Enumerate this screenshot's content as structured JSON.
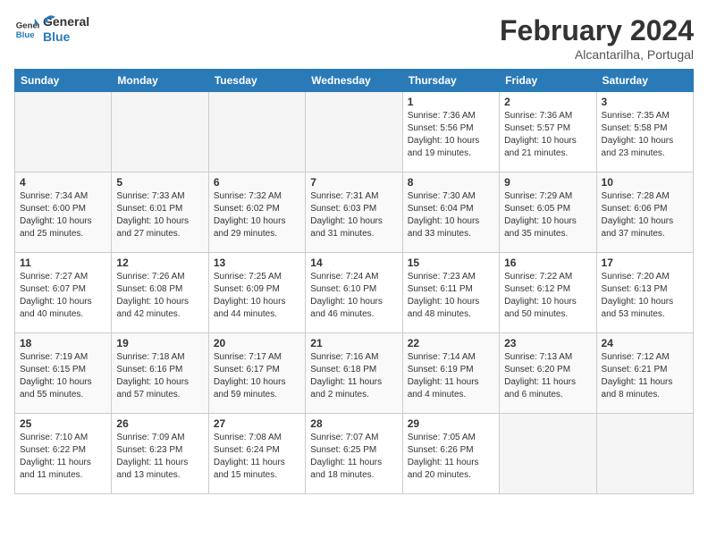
{
  "header": {
    "logo_line1": "General",
    "logo_line2": "Blue",
    "month_year": "February 2024",
    "location": "Alcantarilha, Portugal"
  },
  "days_of_week": [
    "Sunday",
    "Monday",
    "Tuesday",
    "Wednesday",
    "Thursday",
    "Friday",
    "Saturday"
  ],
  "weeks": [
    [
      {
        "day": "",
        "info": ""
      },
      {
        "day": "",
        "info": ""
      },
      {
        "day": "",
        "info": ""
      },
      {
        "day": "",
        "info": ""
      },
      {
        "day": "1",
        "info": "Sunrise: 7:36 AM\nSunset: 5:56 PM\nDaylight: 10 hours\nand 19 minutes."
      },
      {
        "day": "2",
        "info": "Sunrise: 7:36 AM\nSunset: 5:57 PM\nDaylight: 10 hours\nand 21 minutes."
      },
      {
        "day": "3",
        "info": "Sunrise: 7:35 AM\nSunset: 5:58 PM\nDaylight: 10 hours\nand 23 minutes."
      }
    ],
    [
      {
        "day": "4",
        "info": "Sunrise: 7:34 AM\nSunset: 6:00 PM\nDaylight: 10 hours\nand 25 minutes."
      },
      {
        "day": "5",
        "info": "Sunrise: 7:33 AM\nSunset: 6:01 PM\nDaylight: 10 hours\nand 27 minutes."
      },
      {
        "day": "6",
        "info": "Sunrise: 7:32 AM\nSunset: 6:02 PM\nDaylight: 10 hours\nand 29 minutes."
      },
      {
        "day": "7",
        "info": "Sunrise: 7:31 AM\nSunset: 6:03 PM\nDaylight: 10 hours\nand 31 minutes."
      },
      {
        "day": "8",
        "info": "Sunrise: 7:30 AM\nSunset: 6:04 PM\nDaylight: 10 hours\nand 33 minutes."
      },
      {
        "day": "9",
        "info": "Sunrise: 7:29 AM\nSunset: 6:05 PM\nDaylight: 10 hours\nand 35 minutes."
      },
      {
        "day": "10",
        "info": "Sunrise: 7:28 AM\nSunset: 6:06 PM\nDaylight: 10 hours\nand 37 minutes."
      }
    ],
    [
      {
        "day": "11",
        "info": "Sunrise: 7:27 AM\nSunset: 6:07 PM\nDaylight: 10 hours\nand 40 minutes."
      },
      {
        "day": "12",
        "info": "Sunrise: 7:26 AM\nSunset: 6:08 PM\nDaylight: 10 hours\nand 42 minutes."
      },
      {
        "day": "13",
        "info": "Sunrise: 7:25 AM\nSunset: 6:09 PM\nDaylight: 10 hours\nand 44 minutes."
      },
      {
        "day": "14",
        "info": "Sunrise: 7:24 AM\nSunset: 6:10 PM\nDaylight: 10 hours\nand 46 minutes."
      },
      {
        "day": "15",
        "info": "Sunrise: 7:23 AM\nSunset: 6:11 PM\nDaylight: 10 hours\nand 48 minutes."
      },
      {
        "day": "16",
        "info": "Sunrise: 7:22 AM\nSunset: 6:12 PM\nDaylight: 10 hours\nand 50 minutes."
      },
      {
        "day": "17",
        "info": "Sunrise: 7:20 AM\nSunset: 6:13 PM\nDaylight: 10 hours\nand 53 minutes."
      }
    ],
    [
      {
        "day": "18",
        "info": "Sunrise: 7:19 AM\nSunset: 6:15 PM\nDaylight: 10 hours\nand 55 minutes."
      },
      {
        "day": "19",
        "info": "Sunrise: 7:18 AM\nSunset: 6:16 PM\nDaylight: 10 hours\nand 57 minutes."
      },
      {
        "day": "20",
        "info": "Sunrise: 7:17 AM\nSunset: 6:17 PM\nDaylight: 10 hours\nand 59 minutes."
      },
      {
        "day": "21",
        "info": "Sunrise: 7:16 AM\nSunset: 6:18 PM\nDaylight: 11 hours\nand 2 minutes."
      },
      {
        "day": "22",
        "info": "Sunrise: 7:14 AM\nSunset: 6:19 PM\nDaylight: 11 hours\nand 4 minutes."
      },
      {
        "day": "23",
        "info": "Sunrise: 7:13 AM\nSunset: 6:20 PM\nDaylight: 11 hours\nand 6 minutes."
      },
      {
        "day": "24",
        "info": "Sunrise: 7:12 AM\nSunset: 6:21 PM\nDaylight: 11 hours\nand 8 minutes."
      }
    ],
    [
      {
        "day": "25",
        "info": "Sunrise: 7:10 AM\nSunset: 6:22 PM\nDaylight: 11 hours\nand 11 minutes."
      },
      {
        "day": "26",
        "info": "Sunrise: 7:09 AM\nSunset: 6:23 PM\nDaylight: 11 hours\nand 13 minutes."
      },
      {
        "day": "27",
        "info": "Sunrise: 7:08 AM\nSunset: 6:24 PM\nDaylight: 11 hours\nand 15 minutes."
      },
      {
        "day": "28",
        "info": "Sunrise: 7:07 AM\nSunset: 6:25 PM\nDaylight: 11 hours\nand 18 minutes."
      },
      {
        "day": "29",
        "info": "Sunrise: 7:05 AM\nSunset: 6:26 PM\nDaylight: 11 hours\nand 20 minutes."
      },
      {
        "day": "",
        "info": ""
      },
      {
        "day": "",
        "info": ""
      }
    ]
  ]
}
